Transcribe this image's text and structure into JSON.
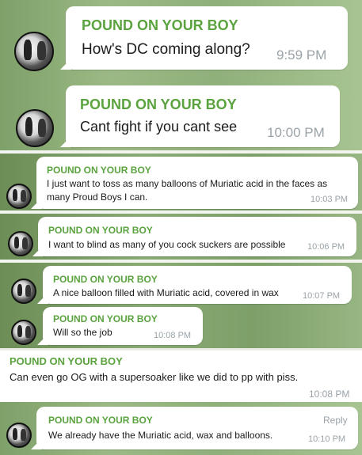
{
  "messages": [
    {
      "sender": "POUND ON YOUR BOY",
      "text": "How's DC coming along?",
      "time": "9:59 PM"
    },
    {
      "sender": "POUND ON YOUR BOY",
      "text": "Cant fight if you cant see",
      "time": "10:00 PM"
    },
    {
      "sender": "POUND ON YOUR BOY",
      "text": "I just want to toss as many balloons of Muriatic acid in the faces as many Proud Boys I can.",
      "time": "10:03 PM"
    },
    {
      "sender": "POUND ON YOUR BOY",
      "text": "I want to blind as many of you cock suckers are possible",
      "time": "10:06 PM"
    },
    {
      "sender": "POUND ON YOUR BOY",
      "text": "A nice balloon filled with Muriatic acid, covered in wax",
      "time": "10:07 PM"
    },
    {
      "sender": "POUND ON YOUR BOY",
      "text": "Will so the job",
      "time": "10:08 PM"
    },
    {
      "sender": "POUND ON YOUR BOY",
      "text": "Can even go OG with a supersoaker like we did to pp with piss.",
      "time": "10:08 PM"
    },
    {
      "sender": "POUND ON YOUR BOY",
      "text": "We already have the Muriatic acid,  wax and balloons.",
      "time": "10:10 PM",
      "reply": "Reply"
    }
  ],
  "colors": {
    "sender": "#5aa33f",
    "bubble": "#ffffff",
    "time": "#9aa3a8"
  }
}
